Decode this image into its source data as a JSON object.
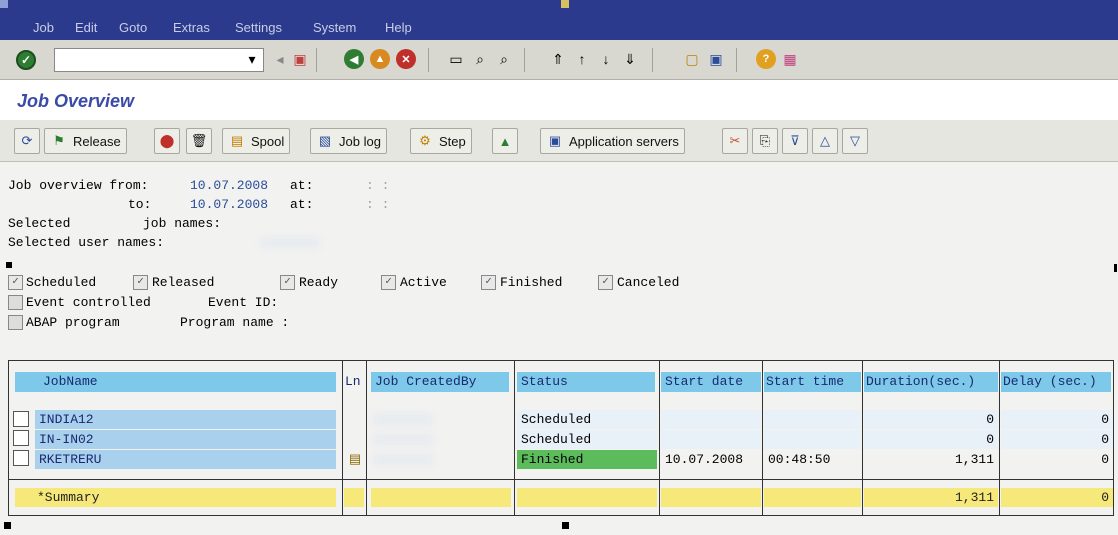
{
  "menu": {
    "items": [
      {
        "label": "Job"
      },
      {
        "label": "Edit"
      },
      {
        "label": "Goto"
      },
      {
        "label": "Extras"
      },
      {
        "label": "Settings"
      },
      {
        "label": "System"
      },
      {
        "label": "Help"
      }
    ]
  },
  "title": "Job Overview",
  "app_toolbar": {
    "release": "Release",
    "spool": "Spool",
    "job_log": "Job log",
    "step": "Step",
    "application_servers": "Application servers"
  },
  "criteria": {
    "line1": "Job overview from:",
    "from_date": "10.07.2008",
    "from_at": "at:",
    "from_time": ": :",
    "line2": "to:",
    "to_date": "10.07.2008",
    "to_at": "at:",
    "to_time": ": :",
    "selected_a": "Selected",
    "job_names": "job names:",
    "user_names": "Selected user names:"
  },
  "status_filters": [
    {
      "label": "Scheduled",
      "checked": true
    },
    {
      "label": "Released",
      "checked": true
    },
    {
      "label": "Ready",
      "checked": true
    },
    {
      "label": "Active",
      "checked": true
    },
    {
      "label": "Finished",
      "checked": true
    },
    {
      "label": "Canceled",
      "checked": true
    }
  ],
  "event": {
    "label": "Event controlled",
    "event_id": "Event ID:"
  },
  "abap": {
    "label": "ABAP program",
    "program_name": "Program name :"
  },
  "table": {
    "headers": [
      "JobName",
      "Ln",
      "Job CreatedBy",
      "Status",
      "Start date",
      "Start time",
      "Duration(sec.)",
      "Delay (sec.)"
    ],
    "rows": [
      {
        "jobname": "INDIA12",
        "status": "Scheduled",
        "start_date": "",
        "start_time": "",
        "duration": "0",
        "delay": "0"
      },
      {
        "jobname": "IN-IN02",
        "status": "Scheduled",
        "start_date": "",
        "start_time": "",
        "duration": "0",
        "delay": "0"
      },
      {
        "jobname": "RKETRERU",
        "status": "Finished",
        "start_date": "10.07.2008",
        "start_time": "00:48:50",
        "duration": "1,311",
        "delay": "0"
      }
    ],
    "summary": {
      "label": "*Summary",
      "duration": "1,311",
      "delay": "0"
    }
  },
  "colors": {
    "menubar": "#2b3a8c",
    "title": "#3a4aa8",
    "header_cell": "#7ec8ea",
    "finished": "#5cbc5c",
    "summary": "#f6e97a"
  }
}
